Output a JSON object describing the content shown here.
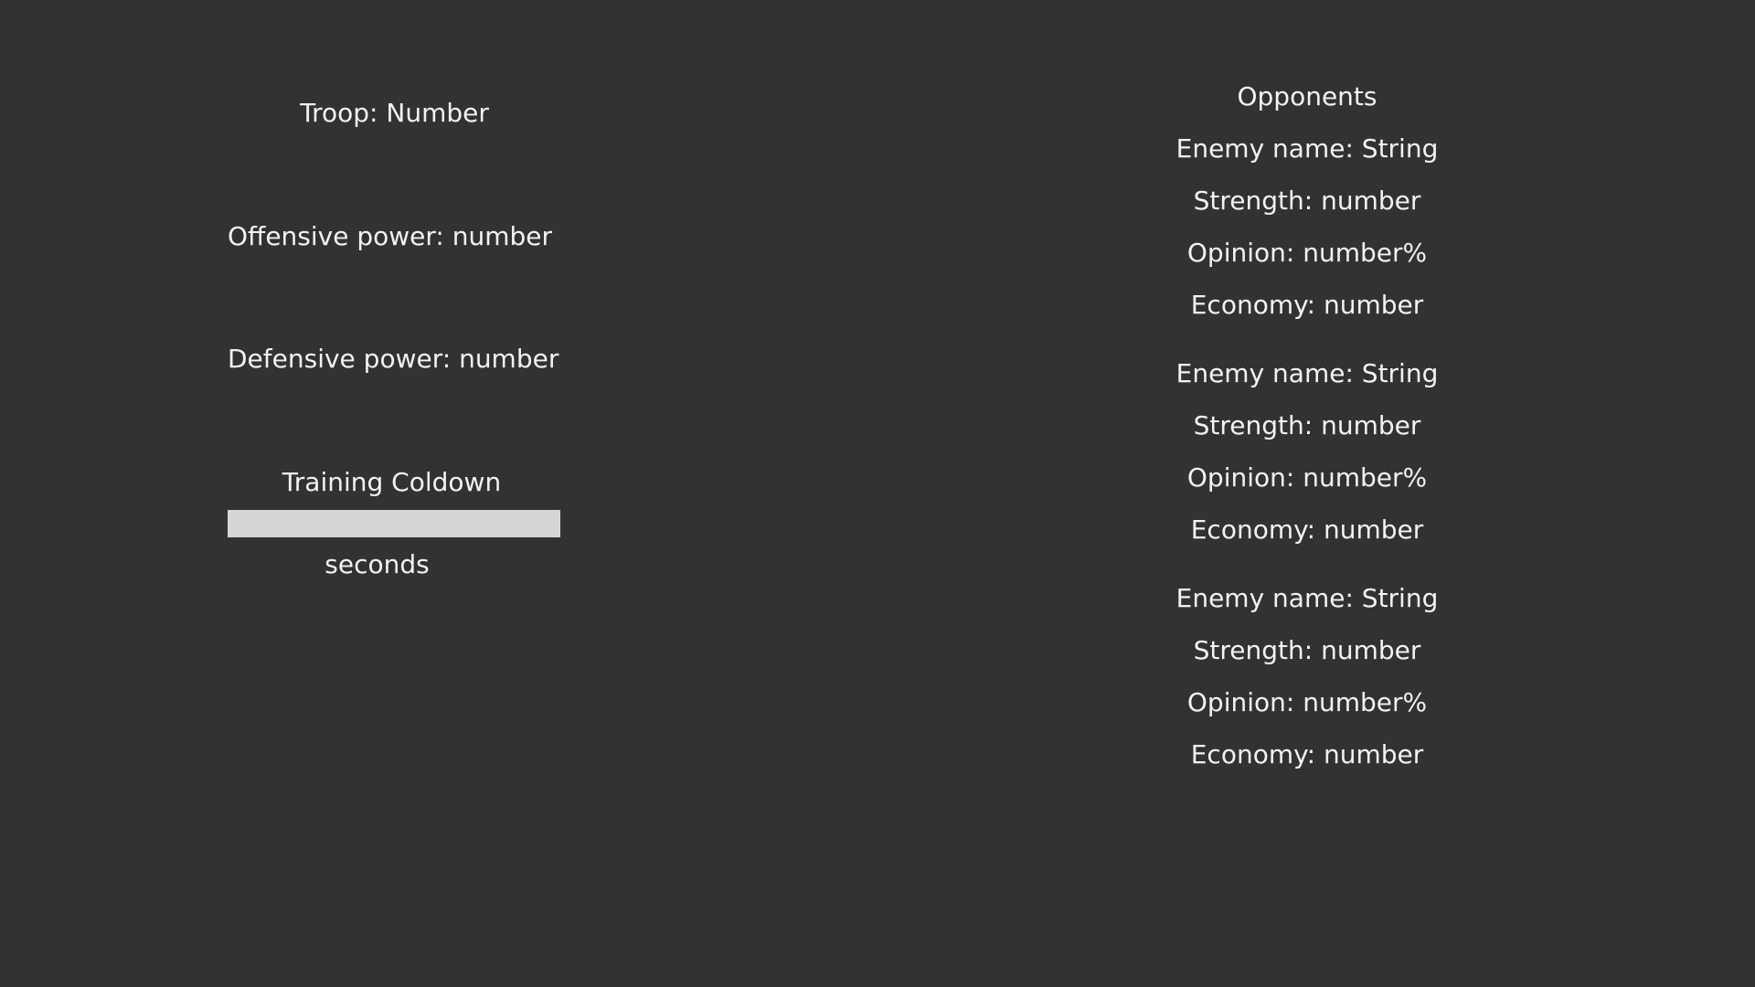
{
  "left_panel": {
    "troop": "Troop: Number",
    "offensive_power": "Offensive power: number",
    "defensive_power": "Defensive power: number",
    "training_cooldown": {
      "title": "Training Coldown",
      "progress": 0,
      "seconds_label": "seconds"
    }
  },
  "right_panel": {
    "title": "Opponents",
    "opponents": [
      {
        "name": "Enemy name: String",
        "strength": "Strength: number",
        "opinion": "Opinion: number%",
        "economy": "Economy: number"
      },
      {
        "name": "Enemy name: String",
        "strength": "Strength: number",
        "opinion": "Opinion: number%",
        "economy": "Economy: number"
      },
      {
        "name": "Enemy name: String",
        "strength": "Strength: number",
        "opinion": "Opinion: number%",
        "economy": "Economy: number"
      }
    ]
  },
  "colors": {
    "background": "#323232",
    "text": "#f2f2f2",
    "bar": "#d6d6d6"
  }
}
